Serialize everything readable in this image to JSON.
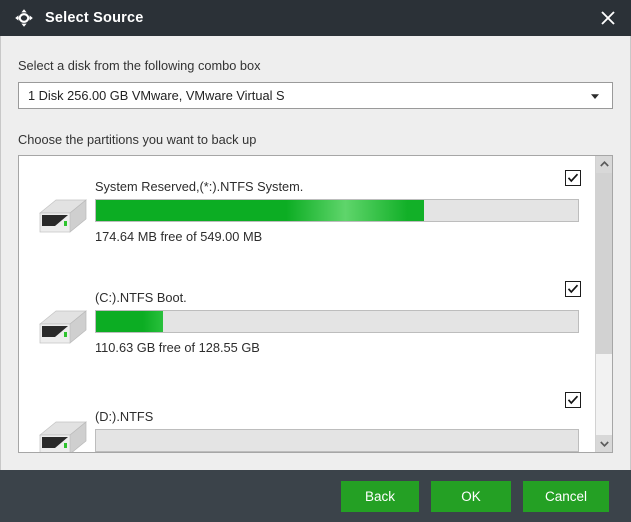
{
  "window": {
    "title": "Select Source",
    "title_icon": "sync-arrows-icon",
    "close_icon": "close-icon",
    "titlebar_color": "#2b3137",
    "chrome_color": "#3b434a"
  },
  "disk_section": {
    "label": "Select a disk from the following combo box",
    "combo": {
      "selected": "1 Disk 256.00 GB VMware,  VMware Virtual S",
      "arrow_icon": "chevron-down-icon"
    }
  },
  "partition_section": {
    "label": "Choose the partitions you want to back up",
    "partitions": [
      {
        "title": "System Reserved,(*:).NTFS System.",
        "usage": "174.64 MB free of 549.00 MB",
        "fill_percent": 68,
        "checked": true,
        "icon": "disk-drive-icon"
      },
      {
        "title": "(C:).NTFS Boot.",
        "usage": "110.63 GB free of 128.55 GB",
        "fill_percent": 14,
        "checked": true,
        "icon": "disk-drive-icon"
      },
      {
        "title": "(D:).NTFS",
        "usage": "",
        "fill_percent": 0,
        "checked": true,
        "icon": "disk-drive-icon"
      }
    ],
    "scrollbar": {
      "up_icon": "chevron-up-icon",
      "down_icon": "chevron-down-icon",
      "thumb_position_percent": 0,
      "thumb_size_percent": 69
    },
    "bar_fill_color": "#0cad23",
    "bar_track_color": "#e4e4e4"
  },
  "footer": {
    "back_label": "Back",
    "ok_label": "OK",
    "cancel_label": "Cancel",
    "button_color": "#24a024"
  }
}
